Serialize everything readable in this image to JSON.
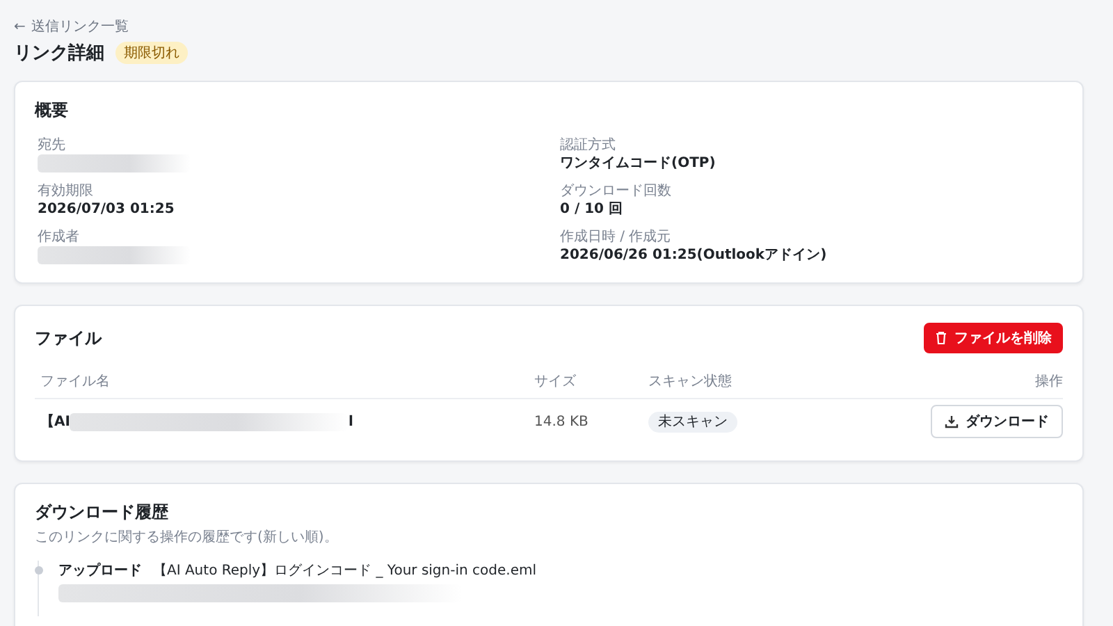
{
  "back_link": {
    "icon": "←",
    "label": "送信リンク一覧"
  },
  "title": "リンク詳細",
  "status_badge": "期限切れ",
  "overview": {
    "heading": "概要",
    "fields": [
      {
        "label": "宛先",
        "kind": "redacted"
      },
      {
        "label": "認証方式",
        "value": "ワンタイムコード(OTP)",
        "kind": "text"
      },
      {
        "label": "有効期限",
        "value": "2026/07/03 01:25",
        "kind": "text"
      },
      {
        "label": "ダウンロード回数",
        "value": "0 / 10 回",
        "kind": "text"
      },
      {
        "label": "作成者",
        "kind": "redacted"
      },
      {
        "label": "作成日時 / 作成元",
        "value": "2026/06/26 01:25(Outlookアドイン)",
        "kind": "text"
      }
    ]
  },
  "files": {
    "heading": "ファイル",
    "delete_button": "ファイルを削除",
    "columns": [
      "ファイル名",
      "サイズ",
      "スキャン状態",
      "操作"
    ],
    "rows": [
      {
        "name_start": "【AI",
        "name_end": "l",
        "size": "14.8 KB",
        "scan_status": "未スキャン",
        "action": "ダウンロード"
      }
    ]
  },
  "history": {
    "heading": "ダウンロード履歴",
    "description": "このリンクに関する操作の履歴です(新しい順)。",
    "entries": [
      {
        "action": "アップロード",
        "file": "【AI Auto Reply】ログインコード _ Your sign-in code.eml"
      }
    ]
  }
}
